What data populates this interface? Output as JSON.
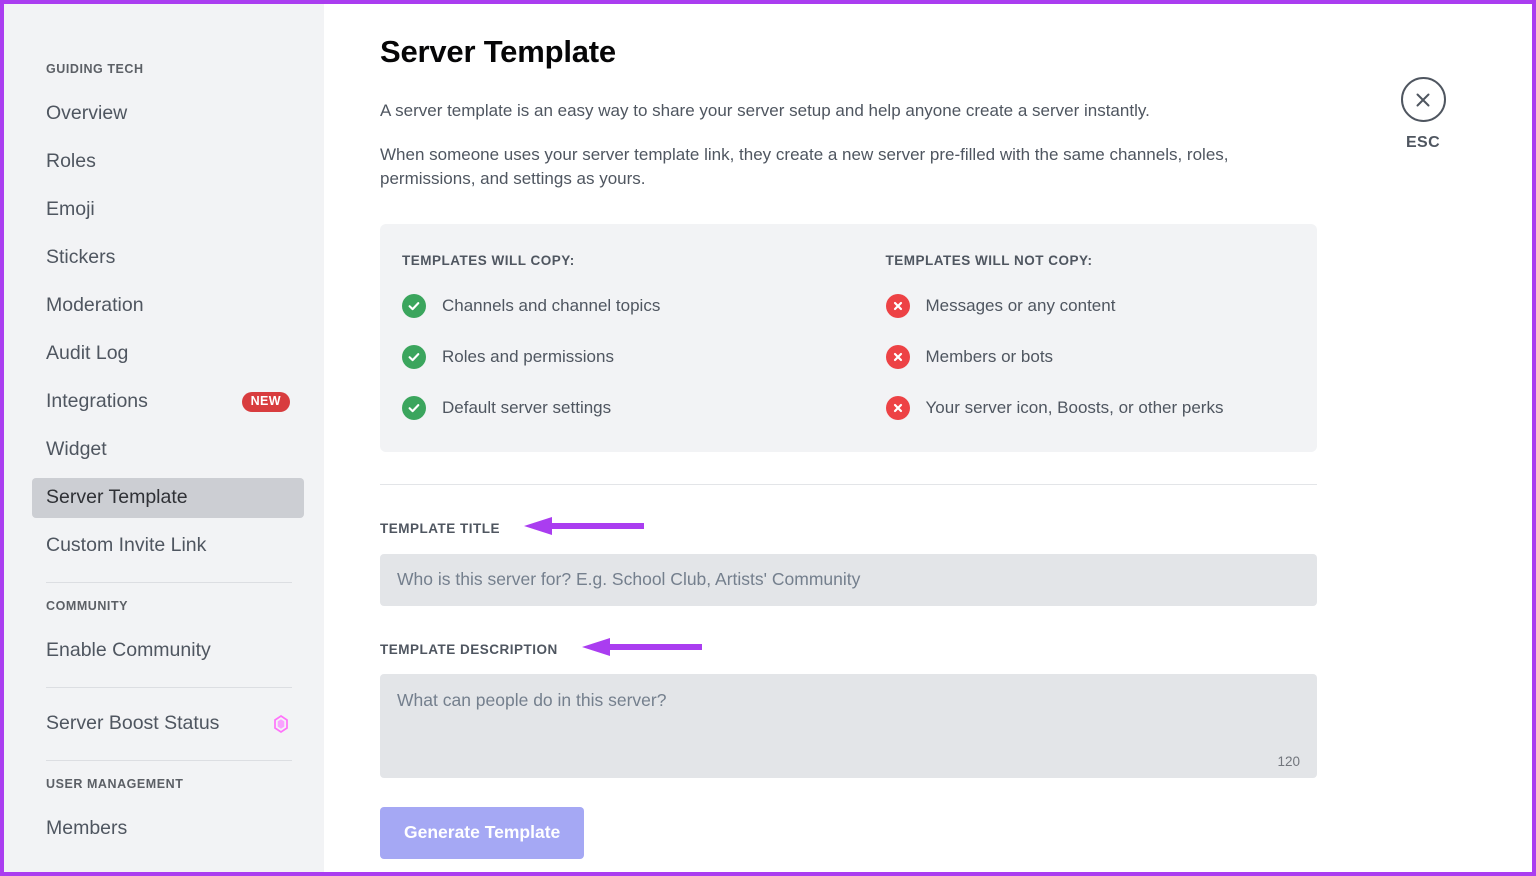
{
  "annotation": {
    "frame_color": "#aa3df0",
    "arrow_color": "#aa3df0"
  },
  "sidebar": {
    "groups": [
      {
        "title": "GUIDING TECH",
        "items": [
          {
            "label": "Overview",
            "active": false
          },
          {
            "label": "Roles",
            "active": false
          },
          {
            "label": "Emoji",
            "active": false
          },
          {
            "label": "Stickers",
            "active": false
          },
          {
            "label": "Moderation",
            "active": false
          },
          {
            "label": "Audit Log",
            "active": false
          },
          {
            "label": "Integrations",
            "active": false,
            "badge": "NEW"
          },
          {
            "label": "Widget",
            "active": false
          },
          {
            "label": "Server Template",
            "active": true
          },
          {
            "label": "Custom Invite Link",
            "active": false
          }
        ]
      },
      {
        "title": "COMMUNITY",
        "items": [
          {
            "label": "Enable Community",
            "active": false
          }
        ]
      },
      {
        "title": "",
        "items": [
          {
            "label": "Server Boost Status",
            "active": false,
            "icon": "boost-diamond-icon"
          }
        ]
      },
      {
        "title": "USER MANAGEMENT",
        "items": [
          {
            "label": "Members",
            "active": false
          }
        ]
      }
    ],
    "badge_color": "#d83c3e",
    "boost_icon_color": "#ff73fa"
  },
  "main": {
    "title": "Server Template",
    "paragraphs": [
      "A server template is an easy way to share your server setup and help anyone create a server instantly.",
      "When someone uses your server template link, they create a new server pre-filled with the same channels, roles, permissions, and settings as yours."
    ],
    "copy_card": {
      "will_copy": {
        "title": "TEMPLATES WILL COPY:",
        "icon": "check-circle-icon",
        "icon_color": "#3ba55d",
        "items": [
          "Channels and channel topics",
          "Roles and permissions",
          "Default server settings"
        ]
      },
      "will_not_copy": {
        "title": "TEMPLATES WILL NOT COPY:",
        "icon": "x-circle-icon",
        "icon_color": "#ed4245",
        "items": [
          "Messages or any content",
          "Members or bots",
          "Your server icon, Boosts, or other perks"
        ]
      }
    },
    "form": {
      "title_label": "TEMPLATE TITLE",
      "title_value": "",
      "title_placeholder": "Who is this server for? E.g. School Club, Artists' Community",
      "description_label": "TEMPLATE DESCRIPTION",
      "description_value": "",
      "description_placeholder": "What can people do in this server?",
      "char_counter": "120",
      "submit_label": "Generate Template",
      "submit_color": "#a5a8f4"
    },
    "close": {
      "label": "ESC",
      "icon": "close-x-icon"
    }
  }
}
